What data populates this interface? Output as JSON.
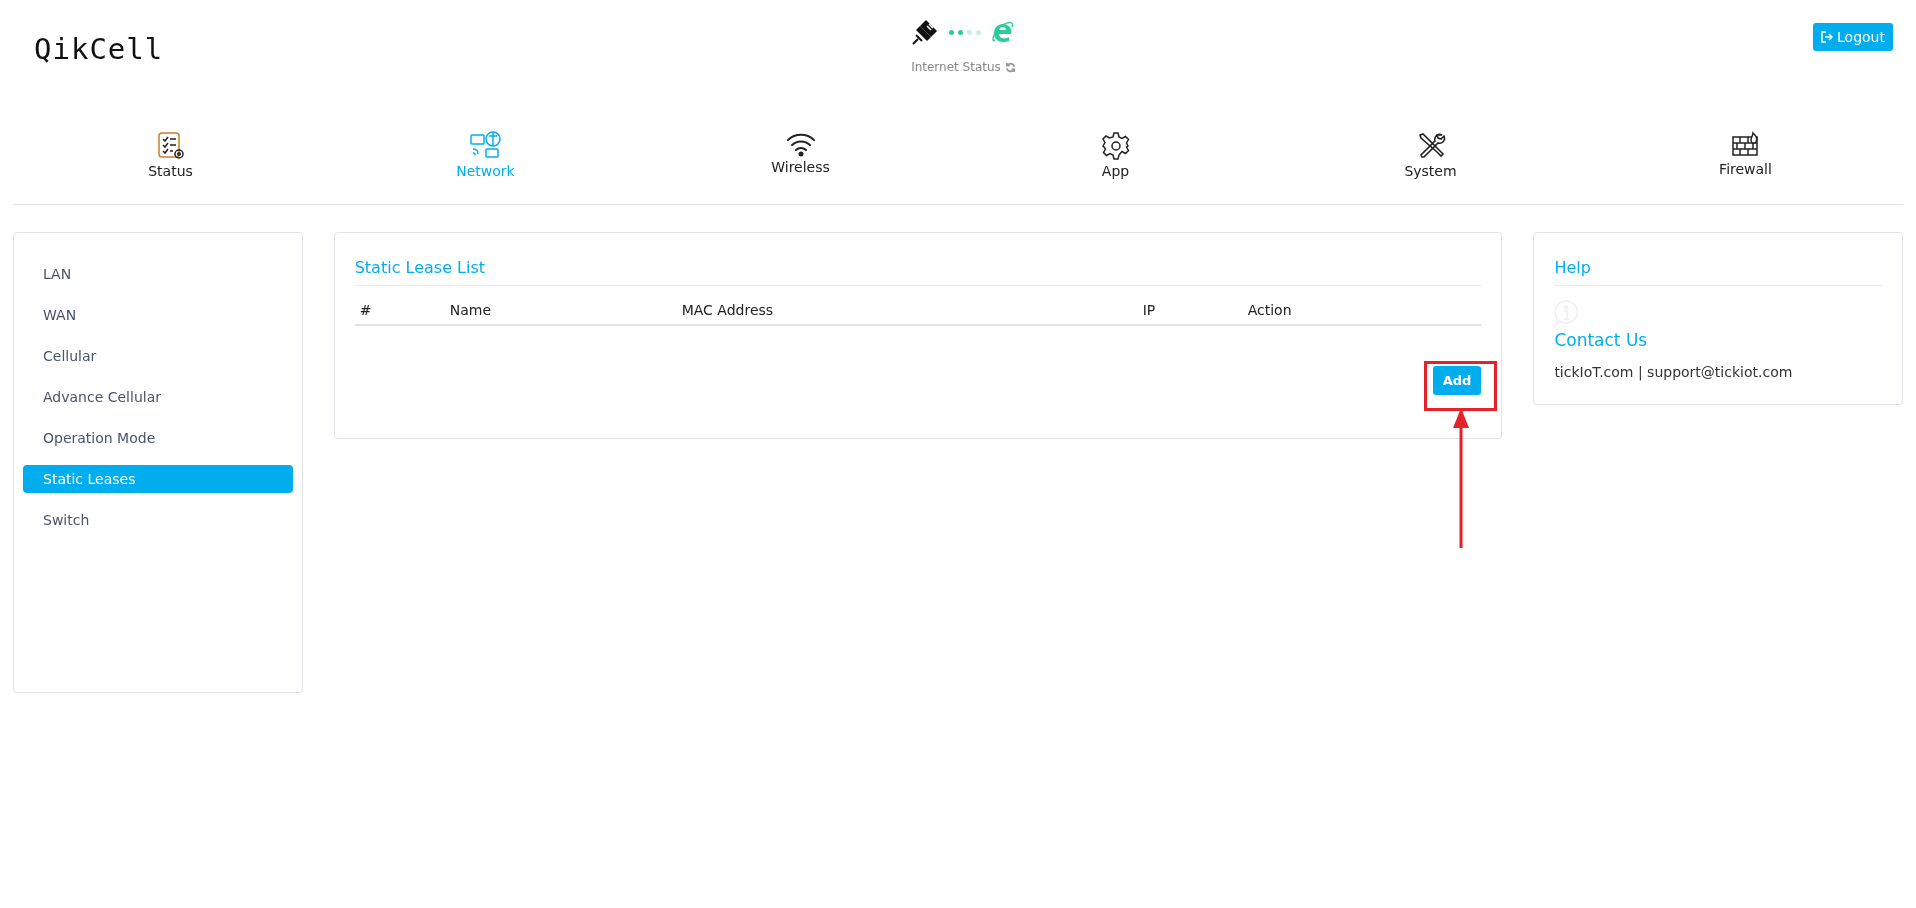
{
  "brand": {
    "logo": "QikCell"
  },
  "internet_status": {
    "label": "Internet Status",
    "dots": [
      {
        "on": true
      },
      {
        "on": true
      },
      {
        "on": false
      },
      {
        "on": false
      }
    ]
  },
  "logout_button": {
    "label": "Logout"
  },
  "tabs": [
    {
      "label": "Status",
      "kind": "status",
      "selected": false
    },
    {
      "label": "Network",
      "kind": "network",
      "selected": true
    },
    {
      "label": "Wireless",
      "kind": "wireless",
      "selected": false
    },
    {
      "label": "App",
      "kind": "app",
      "selected": false
    },
    {
      "label": "System",
      "kind": "system",
      "selected": false
    },
    {
      "label": "Firewall",
      "kind": "firewall",
      "selected": false
    }
  ],
  "sidebar": {
    "items": [
      {
        "label": "LAN",
        "selected": false
      },
      {
        "label": "WAN",
        "selected": false
      },
      {
        "label": "Cellular",
        "selected": false
      },
      {
        "label": "Advance Cellular",
        "selected": false
      },
      {
        "label": "Operation Mode",
        "selected": false
      },
      {
        "label": "Static Leases",
        "selected": true
      },
      {
        "label": "Switch",
        "selected": false
      }
    ]
  },
  "static_lease_list": {
    "title": "Static Lease List",
    "columns": [
      "#",
      "Name",
      "MAC Address",
      "IP",
      "Action"
    ],
    "add_button": "Add"
  },
  "help": {
    "title": "Help",
    "contact_title": "Contact Us",
    "contact_text": "tickIoT.com | support@tickiot.com"
  }
}
